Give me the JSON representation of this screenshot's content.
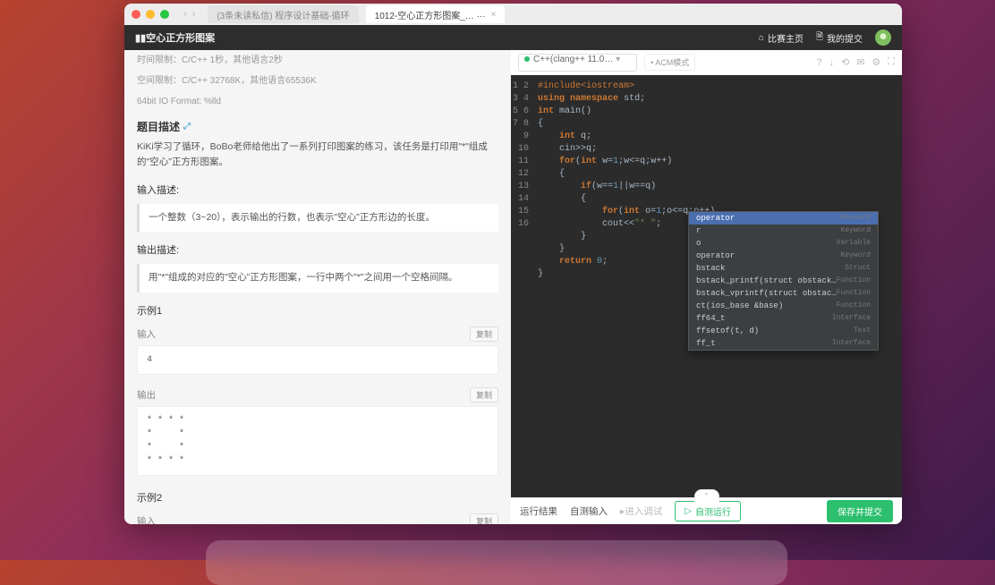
{
  "tabs": [
    {
      "label": "(3条未读私信) 程序设计基础-循环"
    },
    {
      "label": "1012-空心正方形图案_…  ···",
      "active": true
    }
  ],
  "header": {
    "title": "▮▮空心正方形图案",
    "links": {
      "home": "比赛主页",
      "submissions": "我的提交"
    }
  },
  "problem": {
    "meta_time": "时间限制：C/C++ 1秒，其他语言2秒",
    "meta_space": "空间限制：C/C++ 32768K，其他语言65536K",
    "meta_io": "64bit IO Format: %lld",
    "title_label": "题目描述",
    "desc": "KiKi学习了循环，BoBo老师给他出了一系列打印图案的练习，该任务是打印用\"*\"组成的\"空心\"正方形图案。",
    "input_label": "输入描述:",
    "input_desc": "一个整数（3~20），表示输出的行数，也表示\"空心\"正方形边的长度。",
    "output_label": "输出描述:",
    "output_desc": "用\"*\"组成的对应的\"空心\"正方形图案，一行中两个\"*\"之间用一个空格间隔。",
    "example1_label": "示例1",
    "input_title": "输入",
    "output_title": "输出",
    "copy_label": "复制",
    "example1_input": "4",
    "example1_output": "* * * * \n*     * \n*     * \n* * * * ",
    "example2_label": "示例2"
  },
  "editor": {
    "language": "C++(clang++ 11.0…",
    "mode": "• ACM模式",
    "tb_icons": [
      "?",
      "↓",
      "⟲",
      "✉",
      "⚙",
      "⛶"
    ]
  },
  "autocomplete": {
    "items": [
      {
        "text": "operator",
        "kind": "Keyword",
        "sel": true
      },
      {
        "text": "r",
        "kind": "Keyword"
      },
      {
        "text": "o",
        "kind": "Variable"
      },
      {
        "text": "operator",
        "kind": "Keyword"
      },
      {
        "text": "bstack",
        "kind": "Struct"
      },
      {
        "text": "bstack_printf(struct obstack…",
        "kind": "Function"
      },
      {
        "text": "bstack_vprintf(struct obstac…",
        "kind": "Function"
      },
      {
        "text": "ct(ios_base &base)",
        "kind": "Function"
      },
      {
        "text": "ff64_t",
        "kind": "Interface"
      },
      {
        "text": "ffsetof(t, d)",
        "kind": "Text"
      },
      {
        "text": "ff_t",
        "kind": "Interface"
      }
    ]
  },
  "bottom": {
    "tab_result": "运行结果",
    "tab_stdin": "自测输入",
    "tab_debug": "▸进入调试",
    "btn_test": "自测运行",
    "btn_submit": "保存并提交"
  }
}
